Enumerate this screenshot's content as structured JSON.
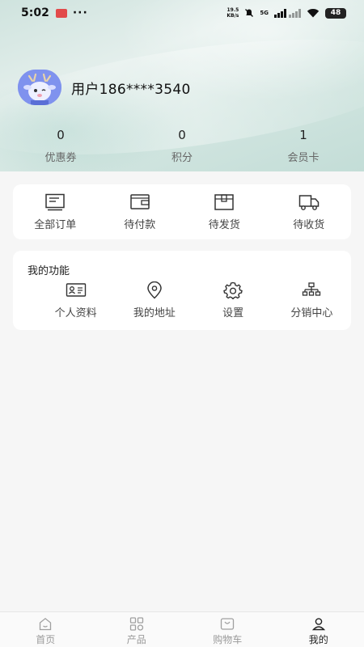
{
  "status_bar": {
    "time": "5:02",
    "extra": "···",
    "net_speed_value": "19.5",
    "net_speed_unit": "KB/s",
    "network": "5G",
    "battery": "48"
  },
  "profile": {
    "username": "用户186****3540"
  },
  "stats": [
    {
      "value": "0",
      "label": "优惠券"
    },
    {
      "value": "0",
      "label": "积分"
    },
    {
      "value": "1",
      "label": "会员卡"
    }
  ],
  "orders": [
    {
      "label": "全部订单",
      "icon": "order-list-icon"
    },
    {
      "label": "待付款",
      "icon": "wallet-icon"
    },
    {
      "label": "待发货",
      "icon": "package-icon"
    },
    {
      "label": "待收货",
      "icon": "truck-icon"
    }
  ],
  "functions": {
    "title": "我的功能",
    "items": [
      {
        "label": "个人资料",
        "icon": "id-card-icon"
      },
      {
        "label": "我的地址",
        "icon": "location-pin-icon"
      },
      {
        "label": "设置",
        "icon": "gear-icon"
      },
      {
        "label": "分销中心",
        "icon": "org-chart-icon"
      }
    ]
  },
  "tabbar": {
    "items": [
      {
        "label": "首页",
        "icon": "home-icon"
      },
      {
        "label": "产品",
        "icon": "grid-icon"
      },
      {
        "label": "购物车",
        "icon": "cart-icon"
      },
      {
        "label": "我的",
        "icon": "user-icon"
      }
    ],
    "active_index": 3
  }
}
